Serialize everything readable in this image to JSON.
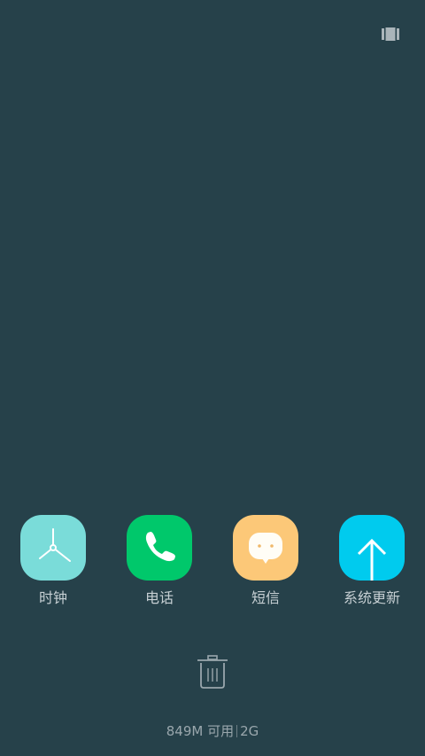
{
  "recents": {
    "apps": [
      {
        "label": "时钟",
        "icon": "clock-icon",
        "color": "#7adcd9"
      },
      {
        "label": "电话",
        "icon": "phone-icon",
        "color": "#00c86b"
      },
      {
        "label": "短信",
        "icon": "message-icon",
        "color": "#fcc878"
      },
      {
        "label": "系统更新",
        "icon": "update-arrow-icon",
        "color": "#00cbee"
      }
    ],
    "memory": {
      "available": "849M 可用",
      "total": "2G"
    }
  },
  "colors": {
    "background": "#26414a"
  }
}
